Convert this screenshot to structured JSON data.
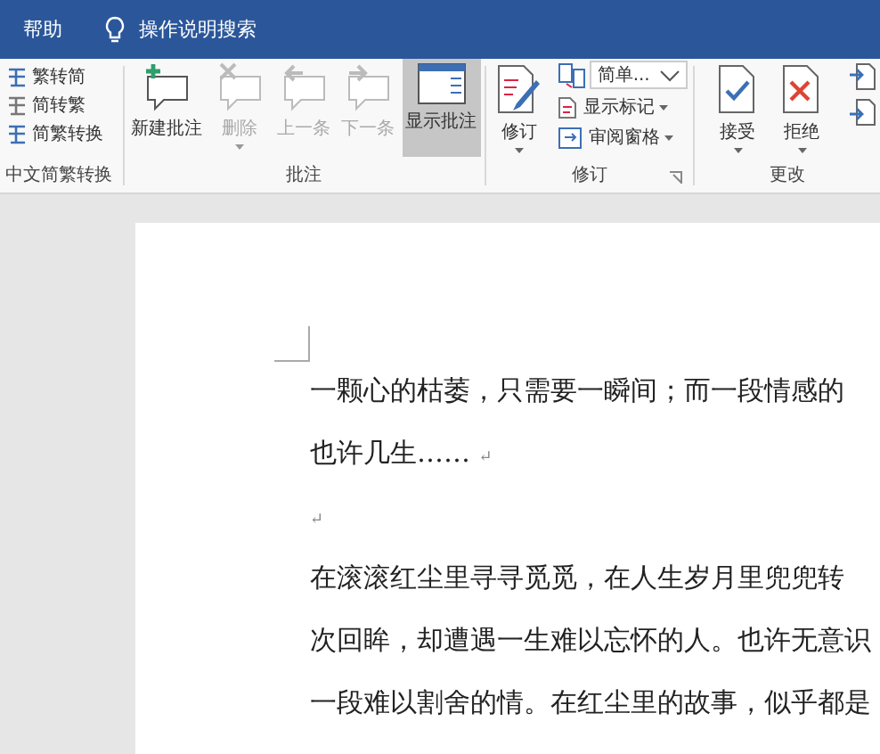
{
  "tabs": [
    {
      "label": "帮助"
    }
  ],
  "tell_me": {
    "placeholder": "操作说明搜索"
  },
  "ribbon": {
    "groups": [
      {
        "label": "中文简繁转换",
        "buttons": [
          {
            "label": "繁转简"
          },
          {
            "label": "简转繁"
          },
          {
            "label": "简繁转换"
          }
        ]
      },
      {
        "label": "批注",
        "buttons": [
          {
            "label": "新建批注",
            "disabled": false,
            "selected": false,
            "dropdown": false
          },
          {
            "label": "删除",
            "disabled": true,
            "selected": false,
            "dropdown": true
          },
          {
            "label": "上一条",
            "disabled": true,
            "selected": false,
            "dropdown": false
          },
          {
            "label": "下一条",
            "disabled": true,
            "selected": false,
            "dropdown": false
          },
          {
            "label": "显示批注",
            "disabled": false,
            "selected": true,
            "dropdown": false
          }
        ]
      },
      {
        "label": "修订",
        "track_button": {
          "label": "修订",
          "dropdown": true
        },
        "markup_select": {
          "value": "简单..."
        },
        "small_buttons": [
          {
            "label": "显示标记",
            "dropdown": true
          },
          {
            "label": "审阅窗格",
            "dropdown": true
          }
        ]
      },
      {
        "label": "更改",
        "buttons": [
          {
            "label": "接受",
            "dropdown": true
          },
          {
            "label": "拒绝",
            "dropdown": true
          }
        ]
      }
    ]
  },
  "document": {
    "lines": [
      {
        "text": "一颗心的枯萎，只需要一瞬间；而一段情感的"
      },
      {
        "text": "也许几生……",
        "mark": "↵"
      },
      {
        "mark": "↵"
      },
      {
        "text": "在滚滚红尘里寻寻觅觅，在人生岁月里兜兜转"
      },
      {
        "text": "次回眸，却遭遇一生难以忘怀的人。也许无意识"
      },
      {
        "text": "一段难以割舍的情。在红尘里的故事，似乎都是"
      }
    ]
  }
}
